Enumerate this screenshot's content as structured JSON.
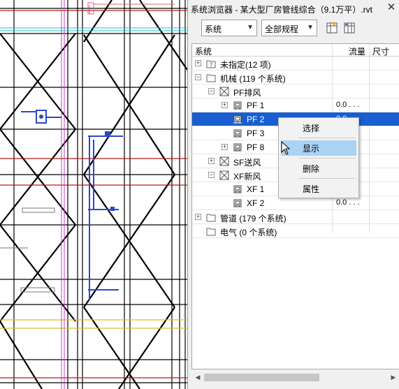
{
  "panel": {
    "title": "系统浏览器 - 某大型厂房管线综合（9.1万平）.rvt",
    "close_symbol": "✕",
    "toolbar": {
      "view_select": "系统",
      "discipline_select": "全部规程",
      "dropdown_icon": "chevron-down-icon",
      "button1_icon": "column-settings-icon",
      "button2_icon": "auto-fit-columns-icon"
    },
    "columns": {
      "system": "系统",
      "flow": "流量",
      "size": "尺寸"
    },
    "tree": [
      {
        "label": "未指定(12 项)",
        "expander": "+",
        "icon": "unassigned-icon"
      },
      {
        "label": "机械 (119 个系统)",
        "expander": "−",
        "icon": "folder-icon"
      },
      {
        "label": "PF排风",
        "expander": "−",
        "icon": "system-icon"
      },
      {
        "label": "PF 1",
        "expander": "+",
        "icon": "equipment-icon",
        "flow": "0.0 . . ."
      },
      {
        "label": "PF 2",
        "icon": "equipment-icon",
        "flow": "0.0 . . .",
        "selected": true
      },
      {
        "label": "PF 3",
        "icon": "equipment-icon",
        "flow": ". . ."
      },
      {
        "label": "PF 8",
        "expander": "+",
        "icon": "equipment-icon",
        "flow": ". . ."
      },
      {
        "label": "SF送风",
        "expander": "+",
        "icon": "system-icon"
      },
      {
        "label": "XF新风",
        "expander": "−",
        "icon": "system-icon"
      },
      {
        "label": "XF 1",
        "icon": "equipment-icon",
        "flow": ". . ."
      },
      {
        "label": "XF 2",
        "icon": "equipment-icon",
        "flow": "0.0 . . ."
      },
      {
        "label": "管道 (179 个系统)",
        "expander": "+",
        "icon": "folder-icon"
      },
      {
        "label": "电气 (0 个系统)",
        "icon": "folder-icon"
      }
    ],
    "scroll_left": "◀",
    "scroll_right": "▶"
  },
  "context_menu": {
    "items": [
      {
        "label": "选择"
      },
      {
        "label": "显示",
        "highlighted": true
      },
      {
        "label": "删除"
      },
      {
        "label": "属性"
      }
    ]
  },
  "colors": {
    "selection": "#1a5fd0",
    "menu_highlight": "#a9d2f5",
    "duct_red": "#b01c1c",
    "duct_blue": "#2c48c8",
    "line_magenta": "#c040c0",
    "line_cyan": "#30b8c8",
    "line_yellow": "#d8c020"
  }
}
